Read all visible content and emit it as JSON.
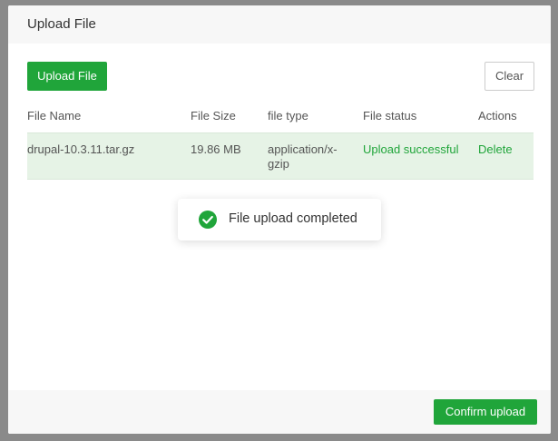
{
  "dialog": {
    "title": "Upload File",
    "upload_button": "Upload File",
    "clear_button": "Clear",
    "confirm_button": "Confirm upload"
  },
  "table": {
    "columns": [
      "File Name",
      "File Size",
      "file type",
      "File status",
      "Actions"
    ],
    "rows": [
      {
        "file_name": "drupal-10.3.11.tar.gz",
        "file_size": "19.86 MB",
        "file_type_line1": "application/x-",
        "file_type_line2": "gzip",
        "status": "Upload successful",
        "action": "Delete"
      }
    ]
  },
  "toast": {
    "message": "File upload completed",
    "icon": "check-circle-icon"
  },
  "colors": {
    "accent": "#20a53a",
    "row_highlight": "#e6f3e6"
  }
}
